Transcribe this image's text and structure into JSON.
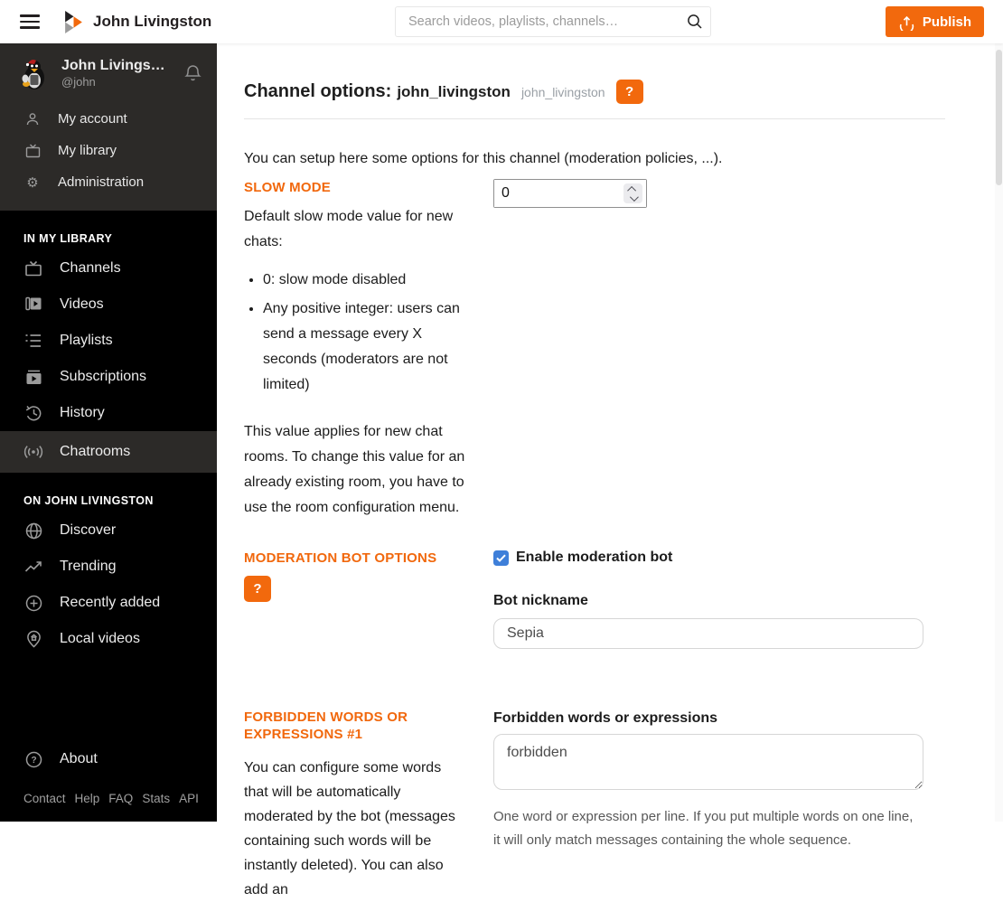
{
  "topbar": {
    "title": "John Livingston",
    "search_placeholder": "Search videos, playlists, channels…",
    "publish_label": "Publish"
  },
  "sidebar": {
    "user": {
      "name": "John Livings…",
      "handle": "@john"
    },
    "account_items": [
      "My account",
      "My library",
      "Administration"
    ],
    "library_header": "IN MY LIBRARY",
    "library_items": [
      "Channels",
      "Videos",
      "Playlists",
      "Subscriptions",
      "History",
      "Chatrooms"
    ],
    "active_item": "Chatrooms",
    "instance_header": "ON JOHN LIVINGSTON",
    "instance_items": [
      "Discover",
      "Trending",
      "Recently added",
      "Local videos"
    ],
    "about_label": "About",
    "footer_links": [
      "Contact",
      "Help",
      "FAQ",
      "Stats",
      "API"
    ]
  },
  "main": {
    "heading": {
      "prefix": "Channel options:",
      "channel": "john_livingston",
      "channel_handle": "john_livingston",
      "help_button": "?"
    },
    "intro": "You can setup here some options for this channel (moderation policies, ...).",
    "slow_mode": {
      "header": "SLOW MODE",
      "value": "0",
      "description": "Default slow mode value for new chats:",
      "bullets": [
        "0: slow mode disabled",
        "Any positive integer: users can send a message every X seconds (moderators are not limited)"
      ],
      "note": "This value applies for new chat rooms. To change this value for an already existing room, you have to use the room configuration menu."
    },
    "moderation_bot": {
      "header": "MODERATION BOT OPTIONS",
      "help_button": "?",
      "enable_label": "Enable moderation bot",
      "enabled": true,
      "nickname_label": "Bot nickname",
      "nickname_value": "Sepia"
    },
    "forbidden_words": {
      "header": "FORBIDDEN WORDS OR EXPRESSIONS #1",
      "description": "You can configure some words that will be automatically moderated by the bot (messages containing such words will be instantly deleted). You can also add an",
      "field_label": "Forbidden words or expressions",
      "field_value": "forbidden",
      "help_text": "One word or expression per line. If you put multiple words on one line, it will only match messages containing the whole sequence."
    }
  },
  "colors": {
    "accent_orange": "#F2690D",
    "checkbox_blue": "#3e7fd9",
    "sidebar_bg": "#000000",
    "sidebar_panel_bg": "#2c2a28"
  }
}
